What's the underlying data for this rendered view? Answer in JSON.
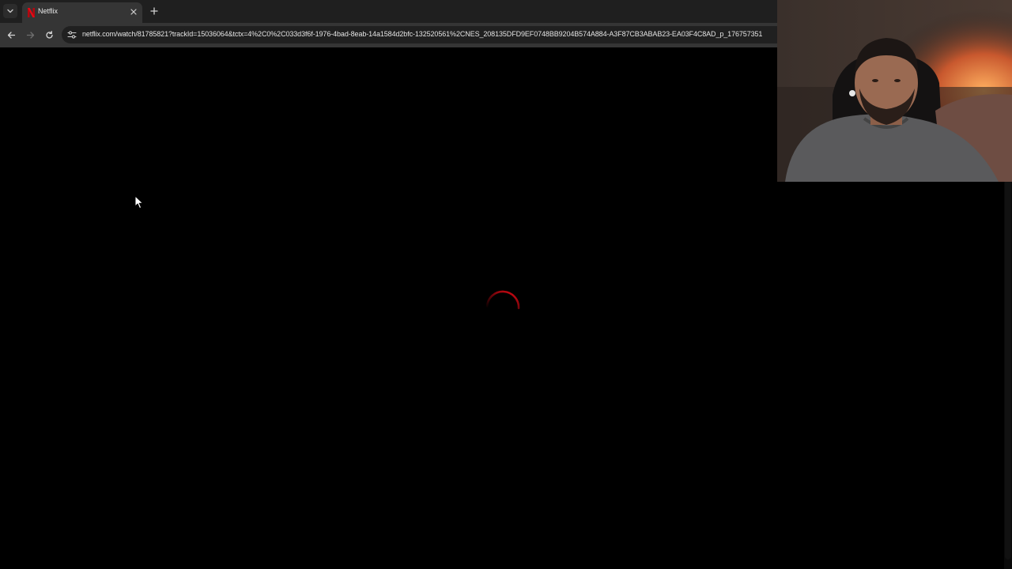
{
  "browser": {
    "tab": {
      "title": "Netflix",
      "favicon": "netflix-n-icon"
    },
    "address_bar": {
      "url": "netflix.com/watch/81785821?trackId=15036064&tctx=4%2C0%2C033d3f6f-1976-4bad-8eab-14a1584d2bfc-132520561%2CNES_208135DFD9EF0748BB9204B574A884-A3F87CB3ABAB23-EA03F4C8AD_p_176757351"
    },
    "icons": {
      "tab_search": "chevron-down-icon",
      "tab_close": "close-icon",
      "new_tab": "plus-icon",
      "back": "arrow-left-icon",
      "forward": "arrow-right-icon",
      "reload": "reload-icon",
      "site_info": "tune-icon"
    }
  },
  "player": {
    "state": "loading",
    "spinner_color": "#e50914"
  },
  "colors": {
    "tabstrip": "#1f1f1f",
    "toolbar": "#353535",
    "omnibox": "#202020",
    "netflix_red": "#e50914"
  }
}
